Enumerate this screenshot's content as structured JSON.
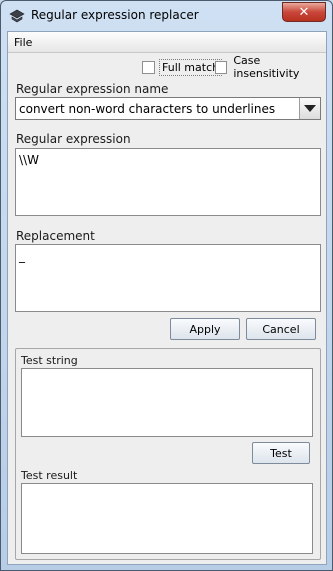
{
  "window": {
    "title": "Regular expression replacer"
  },
  "menu": {
    "file": "File"
  },
  "options": {
    "full_match": "Full match",
    "case_insensitivity": "Case insensitivity"
  },
  "regex_name": {
    "label": "Regular expression name",
    "value": "convert non-word characters to underlines"
  },
  "regex": {
    "label": "Regular expression",
    "value": "\\\\W"
  },
  "replacement": {
    "label": "Replacement",
    "value": "_"
  },
  "actions": {
    "apply": "Apply",
    "cancel": "Cancel"
  },
  "test": {
    "string_label": "Test string",
    "string_value": "",
    "test_button": "Test",
    "result_label": "Test result",
    "result_value": ""
  }
}
